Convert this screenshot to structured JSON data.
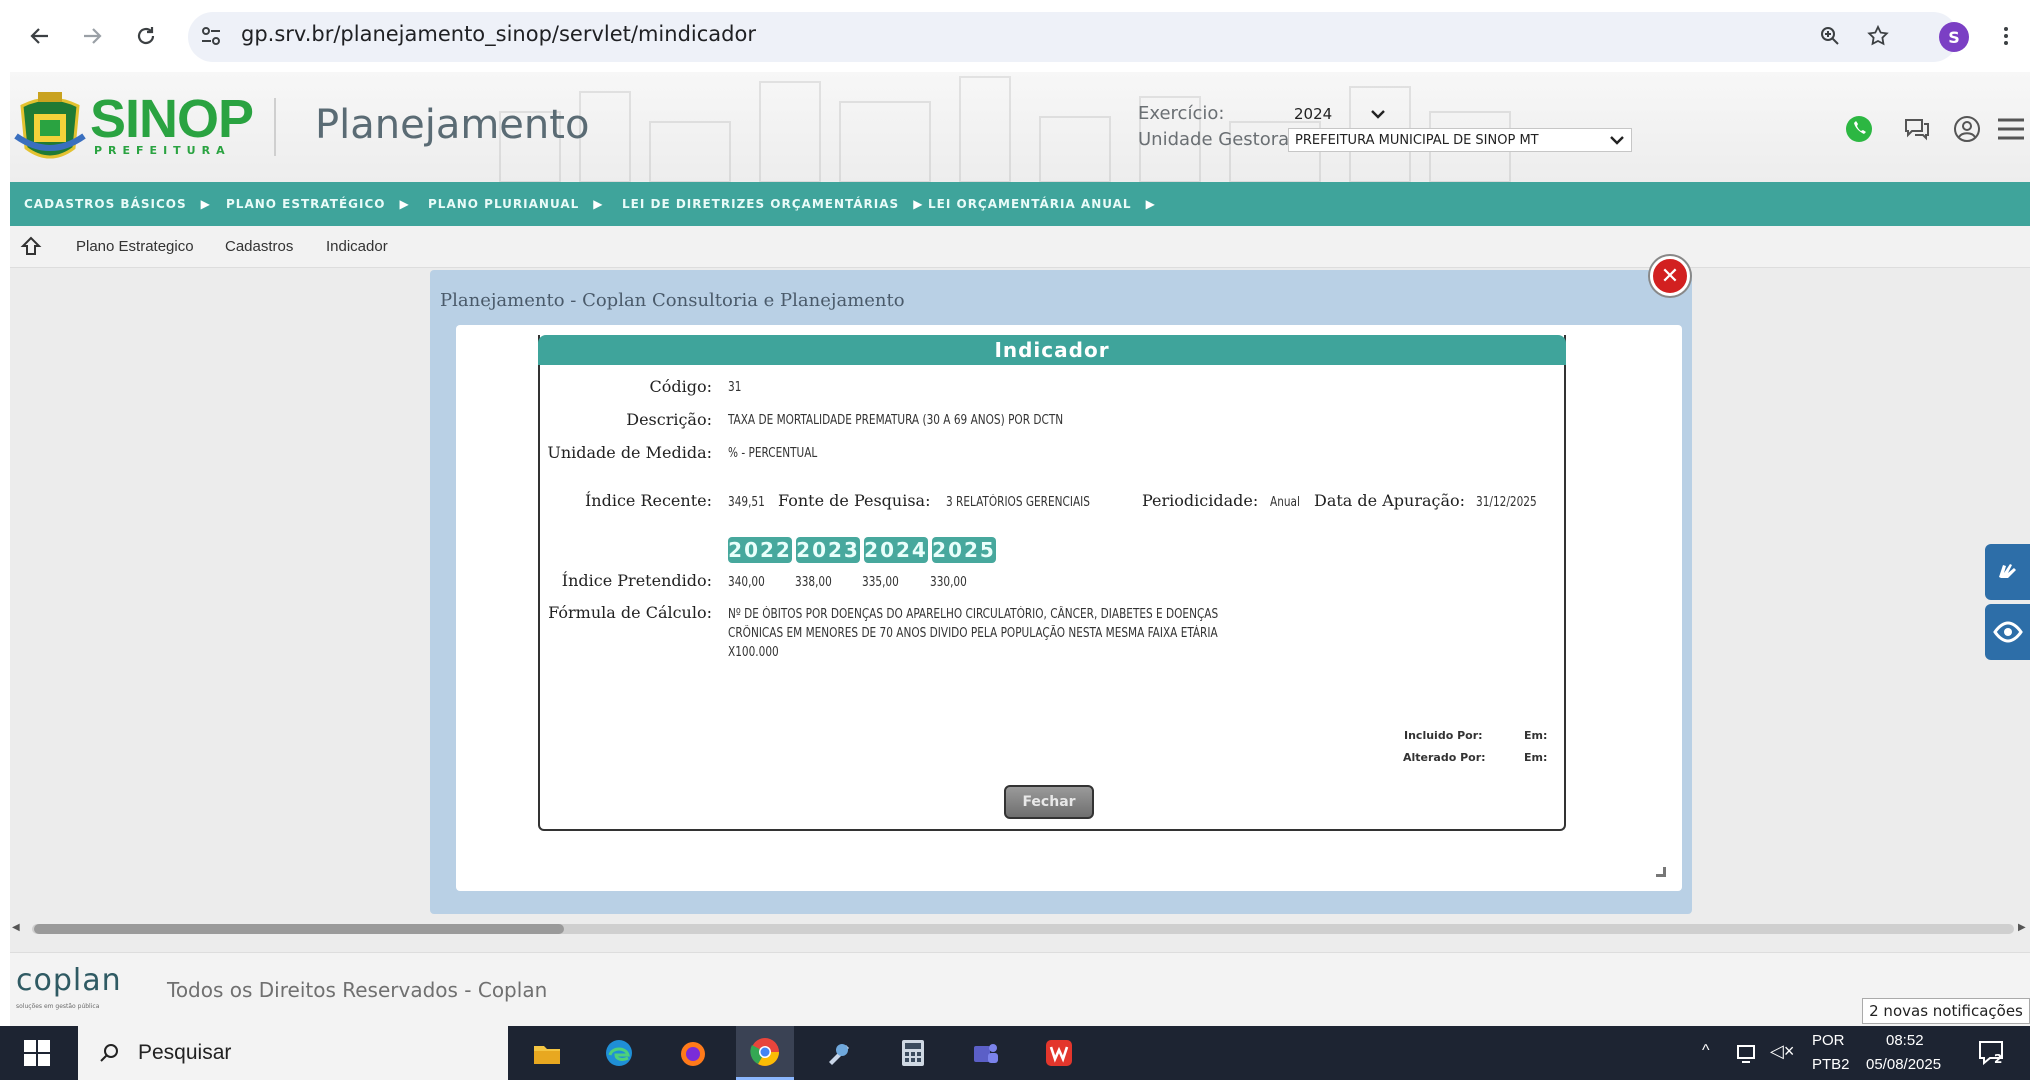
{
  "browser": {
    "url": "gp.srv.br/planejamento_sinop/servlet/mindicador",
    "profile_initial": "S",
    "nav_icons": [
      "back-icon",
      "forward-icon",
      "reload-icon"
    ],
    "right_icons": [
      "zoom-icon",
      "star-icon",
      "kebab-menu-icon"
    ]
  },
  "header": {
    "logo_text": "SINOP",
    "logo_sub": "PREFEITURA",
    "title": "Planejamento",
    "exercicio_label": "Exercício:",
    "exercicio_value": "2024",
    "unidade_label": "Unidade Gestora:",
    "unidade_value": "PREFEITURA MUNICIPAL DE SINOP MT",
    "whatsapp_color": "#2cb742"
  },
  "menu": {
    "items": [
      {
        "label": "CADASTROS BÁSICOS"
      },
      {
        "label": "PLANO ESTRATÉGICO"
      },
      {
        "label": "PLANO PLURIANUAL"
      },
      {
        "label": "LEI DE DIRETRIZES ORÇAMENTÁRIAS"
      },
      {
        "label": "LEI ORÇAMENTÁRIA ANUAL"
      }
    ]
  },
  "breadcrumb": [
    "Plano Estrategico",
    "Cadastros",
    "Indicador"
  ],
  "modal": {
    "title": "Planejamento - Coplan Consultoria e Planejamento",
    "panel_title": "Indicador",
    "fields": {
      "codigo_label": "Código:",
      "codigo": "31",
      "descricao_label": "Descrição:",
      "descricao": "TAXA DE MORTALIDADE PREMATURA (30 A 69 ANOS) POR DCTN",
      "unidade_label": "Unidade de Medida:",
      "unidade": "% - PERCENTUAL",
      "indice_recente_label": "Índice Recente:",
      "indice_recente": "349,51",
      "fonte_label": "Fonte de Pesquisa:",
      "fonte": "3 RELATÓRIOS GERENCIAIS",
      "periodicidade_label": "Periodicidade:",
      "periodicidade": "Anual",
      "data_label": "Data de Apuração:",
      "data": "31/12/2025",
      "indice_pretendido_label": "Índice Pretendido:",
      "years": [
        "2022",
        "2023",
        "2024",
        "2025"
      ],
      "targets": [
        "340,00",
        "338,00",
        "335,00",
        "330,00"
      ],
      "formula_label": "Fórmula de Cálculo:",
      "formula_line1": "Nº DE ÓBITOS POR DOENÇAS DO APARELHO CIRCULATÓRIO, CÂNCER, DIABETES E DOENÇAS",
      "formula_line2": "CRÔNICAS EM MENORES DE 70 ANOS DIVIDO PELA POPULAÇÃO NESTA MESMA FAIXA ETÁRIA",
      "formula_line3": "X100.000",
      "incluido_label": "Incluido Por:",
      "alterado_label": "Alterado Por:",
      "em_label": "Em:",
      "fechar": "Fechar"
    }
  },
  "footer": {
    "logo": "coplan",
    "tagline": "soluções em gestão pública",
    "text": "Todos os Direitos Reservados - Coplan"
  },
  "notification": "2 novas notificações",
  "taskbar": {
    "search": "Pesquisar",
    "lang": "POR",
    "layout": "PTB2",
    "time": "08:52",
    "date": "05/08/2025",
    "notif_count": "2"
  }
}
